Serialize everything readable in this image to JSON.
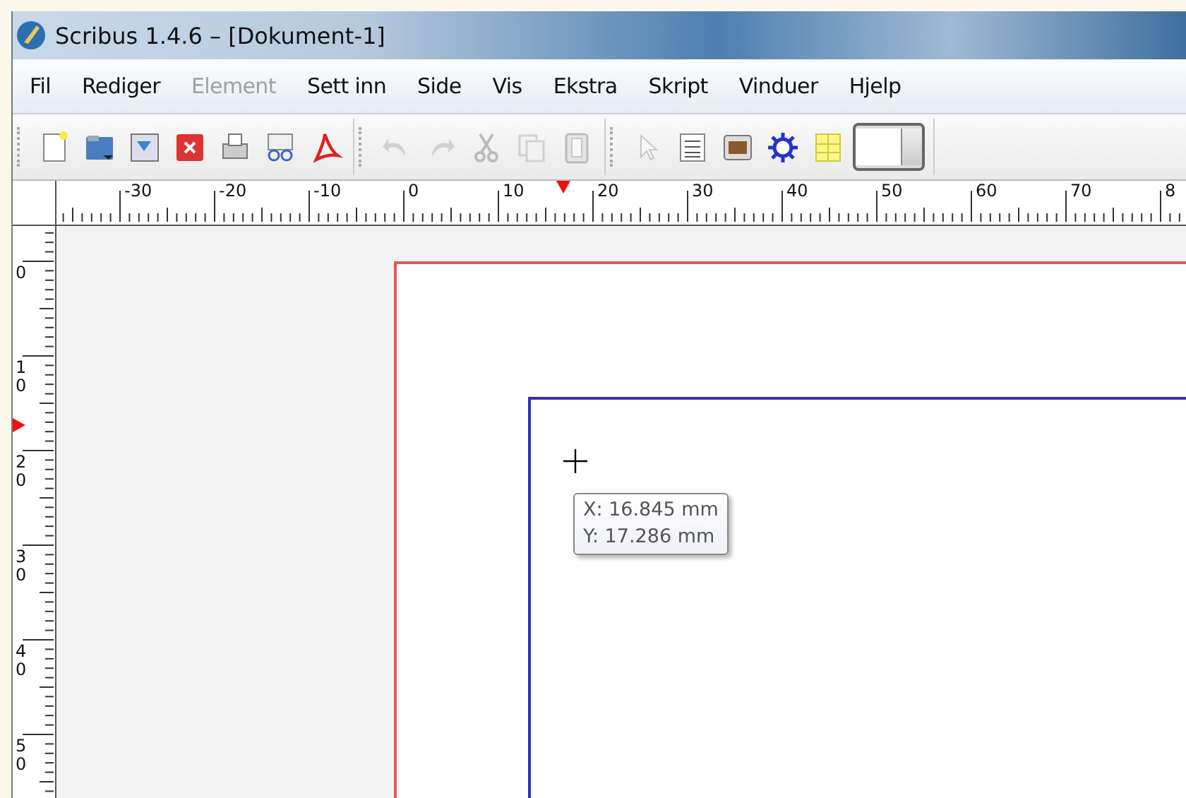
{
  "window": {
    "title": "Scribus 1.4.6 – [Dokument-1]"
  },
  "menu": [
    {
      "label": "Fil",
      "disabled": false
    },
    {
      "label": "Rediger",
      "disabled": false
    },
    {
      "label": "Element",
      "disabled": true
    },
    {
      "label": "Sett inn",
      "disabled": false
    },
    {
      "label": "Side",
      "disabled": false
    },
    {
      "label": "Vis",
      "disabled": false
    },
    {
      "label": "Ekstra",
      "disabled": false
    },
    {
      "label": "Skript",
      "disabled": false
    },
    {
      "label": "Vinduer",
      "disabled": false
    },
    {
      "label": "Hjelp",
      "disabled": false
    }
  ],
  "toolbar": [
    [
      {
        "kind": "new",
        "disabled": false
      },
      {
        "kind": "open",
        "disabled": false
      },
      {
        "kind": "save",
        "disabled": false
      },
      {
        "kind": "close",
        "disabled": false
      },
      {
        "kind": "print",
        "disabled": false
      },
      {
        "kind": "preflight",
        "disabled": false
      },
      {
        "kind": "pdf",
        "disabled": false
      }
    ],
    [
      {
        "kind": "undo",
        "disabled": true
      },
      {
        "kind": "redo",
        "disabled": true
      },
      {
        "kind": "cut",
        "disabled": true
      },
      {
        "kind": "copy",
        "disabled": true
      },
      {
        "kind": "paste",
        "disabled": true
      }
    ],
    [
      {
        "kind": "select",
        "disabled": true
      },
      {
        "kind": "text",
        "disabled": false
      },
      {
        "kind": "image",
        "disabled": false
      },
      {
        "kind": "render",
        "disabled": false
      },
      {
        "kind": "table",
        "disabled": false
      },
      {
        "kind": "shape",
        "disabled": false
      }
    ]
  ],
  "horizontal_ruler": {
    "labels": [
      "-30",
      "-20",
      "-10",
      "0",
      "10",
      "20",
      "30",
      "40",
      "50",
      "60",
      "70",
      "8"
    ],
    "pointer": true
  },
  "vertical_ruler": {
    "labels": [
      "0",
      "10",
      "20",
      "30",
      "40",
      "50"
    ],
    "pointer": true
  },
  "tooltip": {
    "lines": [
      "X: 16.845 mm",
      "Y: 17.286 mm"
    ]
  }
}
